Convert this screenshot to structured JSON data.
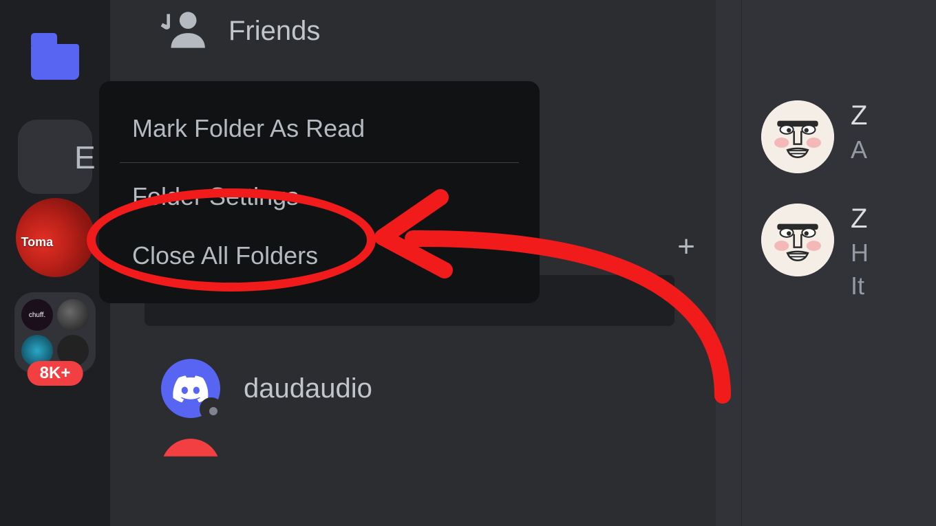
{
  "app": "Discord",
  "colors": {
    "blurple": "#5865f2",
    "red": "#f23f42",
    "annotation": "#f21b1b",
    "bg_dark": "#1e1f22",
    "bg_mid": "#2b2d31",
    "bg_main": "#313338",
    "context_bg": "#111214"
  },
  "server_sidebar": {
    "folder_icon": "folder",
    "gray_folder_letter": "E",
    "tomato_label": "Toma",
    "badge": "8K+",
    "chuff_label": "chuff."
  },
  "channel_panel": {
    "friends_label": "Friends",
    "plus": "+",
    "dm": {
      "name": "daudaudio"
    }
  },
  "context_menu": {
    "items": [
      {
        "label": "Mark Folder As Read"
      },
      {
        "label": "Folder Settings"
      },
      {
        "label": "Close All Folders"
      }
    ]
  },
  "right_panel": {
    "members": [
      {
        "name_partial": "Z",
        "sub_partial": "A"
      },
      {
        "name_partial": "Z",
        "sub_lines": [
          "H",
          "It"
        ]
      }
    ]
  },
  "annotation": {
    "highlighted_item": "Folder Settings"
  }
}
